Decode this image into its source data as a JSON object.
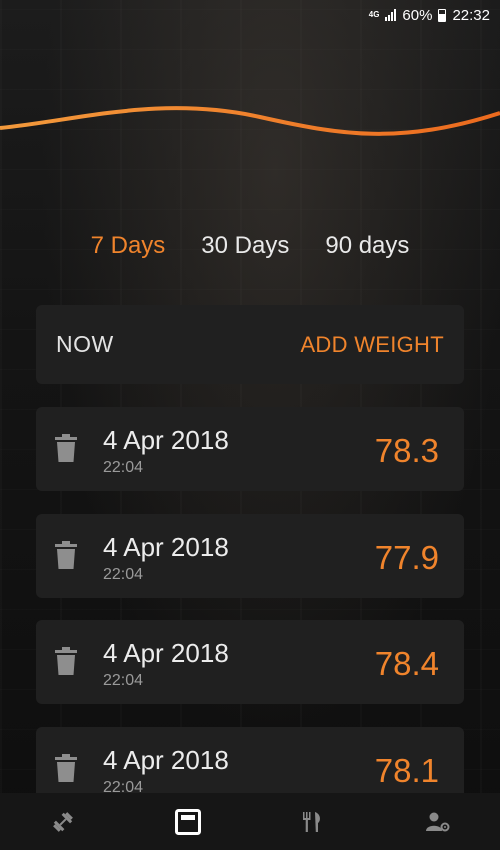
{
  "status_bar": {
    "network": "4G",
    "battery": "60%",
    "time": "22:32"
  },
  "colors": {
    "accent": "#f0842c",
    "card": "#202020",
    "background": "#111111"
  },
  "range_tabs": [
    {
      "label": "7 Days",
      "active": true
    },
    {
      "label": "30 Days",
      "active": false
    },
    {
      "label": "90 days",
      "active": false
    }
  ],
  "now_card": {
    "label": "NOW",
    "action": "ADD WEIGHT"
  },
  "entries": [
    {
      "date": "4 Apr 2018",
      "time": "22:04",
      "weight": "78.3"
    },
    {
      "date": "4 Apr 2018",
      "time": "22:04",
      "weight": "77.9"
    },
    {
      "date": "4 Apr 2018",
      "time": "22:04",
      "weight": "78.4"
    },
    {
      "date": "4 Apr 2018",
      "time": "22:04",
      "weight": "78.1"
    }
  ],
  "bottom_nav": [
    {
      "icon": "dumbbell-icon",
      "active": false
    },
    {
      "icon": "scale-icon",
      "active": true
    },
    {
      "icon": "fork-knife-icon",
      "active": false
    },
    {
      "icon": "user-settings-icon",
      "active": false
    }
  ]
}
